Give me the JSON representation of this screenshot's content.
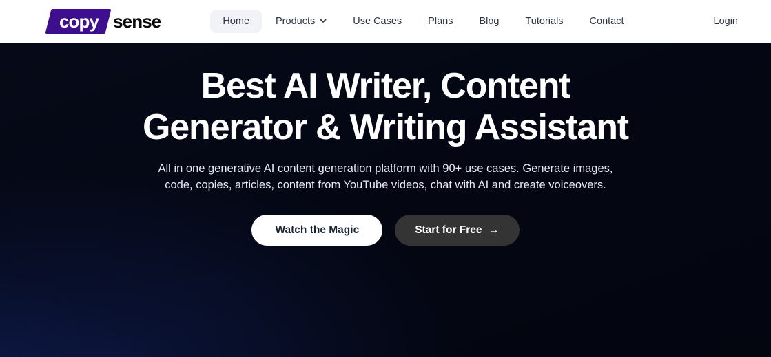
{
  "brand": {
    "mark_text": "copy",
    "word_text": "sense",
    "mark_color": "#3d0f8f",
    "word_color": "#0b0b0b"
  },
  "header": {
    "background": "#ffffff",
    "nav": [
      {
        "label": "Home",
        "active": true,
        "has_dropdown": false
      },
      {
        "label": "Products",
        "active": false,
        "has_dropdown": true,
        "icon": "chevron-down-icon"
      },
      {
        "label": "Use Cases",
        "active": false,
        "has_dropdown": false
      },
      {
        "label": "Plans",
        "active": false,
        "has_dropdown": false
      },
      {
        "label": "Blog",
        "active": false,
        "has_dropdown": false
      },
      {
        "label": "Tutorials",
        "active": false,
        "has_dropdown": false
      },
      {
        "label": "Contact",
        "active": false,
        "has_dropdown": false
      }
    ],
    "login_label": "Login",
    "active_pill_color": "#f1f3f8",
    "nav_text_color": "#2b3445"
  },
  "hero": {
    "background_base": "#03050f",
    "glow_color": "#162c78",
    "title_line_1": "Best AI Writer, Content",
    "title_line_2": "Generator & Writing Assistant",
    "title_color": "#ffffff",
    "subtitle": "All in one generative AI content generation platform with 90+ use cases. Generate images, code, copies, articles, content from YouTube videos, chat with AI and create voiceovers.",
    "subtitle_color": "#e7eaf2",
    "buttons": {
      "secondary_label": "Watch the Magic",
      "secondary_bg": "#ffffff",
      "secondary_text_color": "#1b2434",
      "primary_label": "Start for Free",
      "primary_arrow": "→",
      "primary_bg": "#343434",
      "primary_text_color": "#ffffff"
    }
  }
}
